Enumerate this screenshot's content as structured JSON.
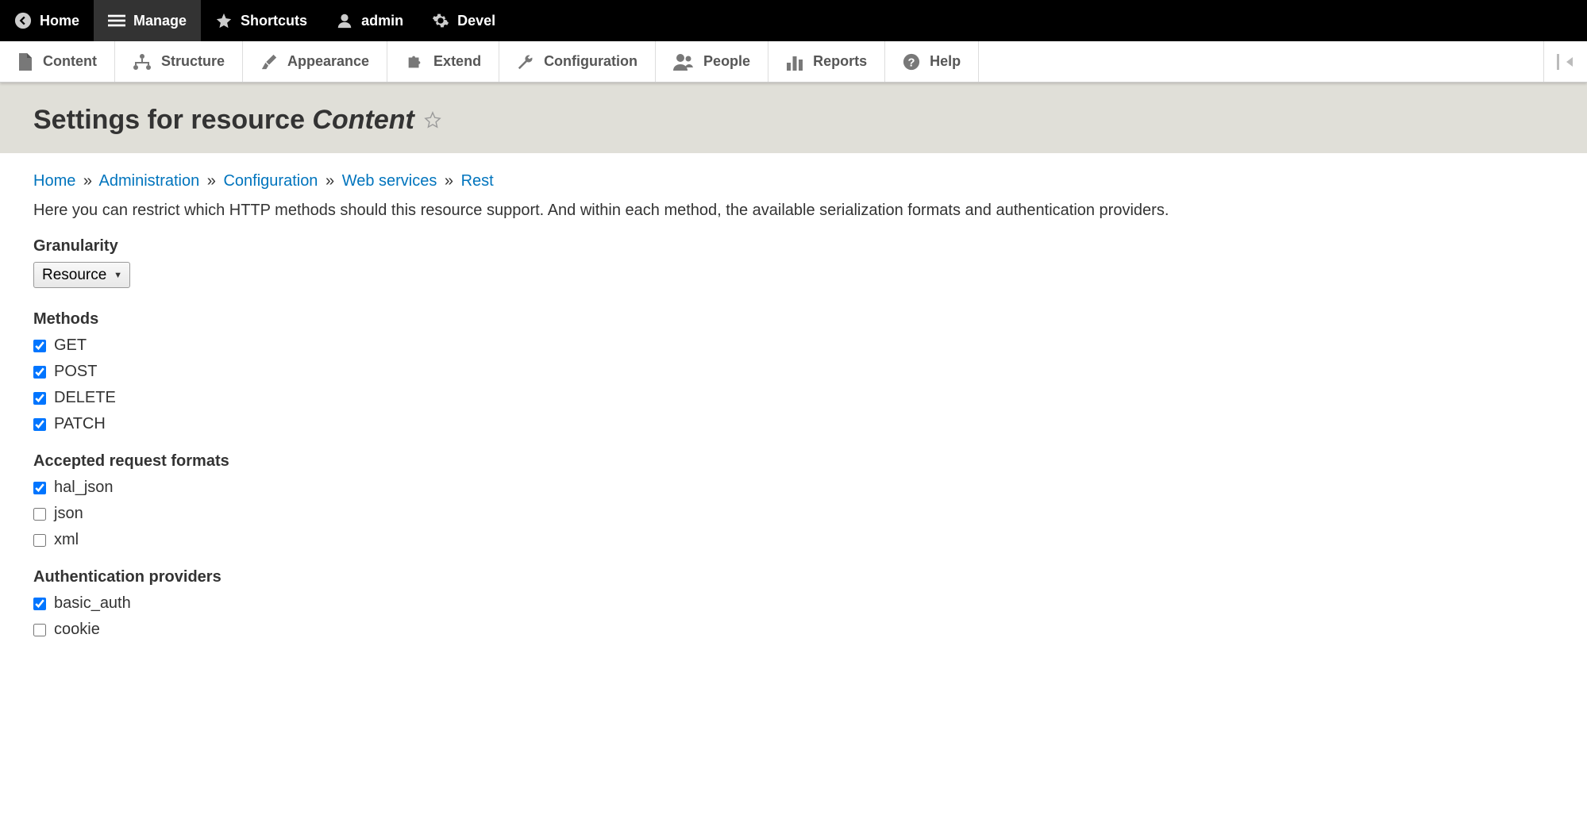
{
  "toolbar_top": {
    "back": "Home",
    "manage": "Manage",
    "shortcuts": "Shortcuts",
    "user": "admin",
    "devel": "Devel"
  },
  "toolbar_secondary": {
    "content": "Content",
    "structure": "Structure",
    "appearance": "Appearance",
    "extend": "Extend",
    "configuration": "Configuration",
    "people": "People",
    "reports": "Reports",
    "help": "Help"
  },
  "page_title_prefix": "Settings for resource ",
  "page_title_em": "Content",
  "breadcrumb": {
    "home": "Home",
    "admin": "Administration",
    "config": "Configuration",
    "web": "Web services",
    "rest": "Rest"
  },
  "description": "Here you can restrict which HTTP methods should this resource support. And within each method, the available serialization formats and authentication providers.",
  "granularity_label": "Granularity",
  "granularity_value": "Resource",
  "methods_label": "Methods",
  "methods": [
    {
      "label": "GET",
      "checked": true
    },
    {
      "label": "POST",
      "checked": true
    },
    {
      "label": "DELETE",
      "checked": true
    },
    {
      "label": "PATCH",
      "checked": true
    }
  ],
  "formats_label": "Accepted request formats",
  "formats": [
    {
      "label": "hal_json",
      "checked": true
    },
    {
      "label": "json",
      "checked": false
    },
    {
      "label": "xml",
      "checked": false
    }
  ],
  "auth_label": "Authentication providers",
  "auth": [
    {
      "label": "basic_auth",
      "checked": true
    },
    {
      "label": "cookie",
      "checked": false
    }
  ]
}
